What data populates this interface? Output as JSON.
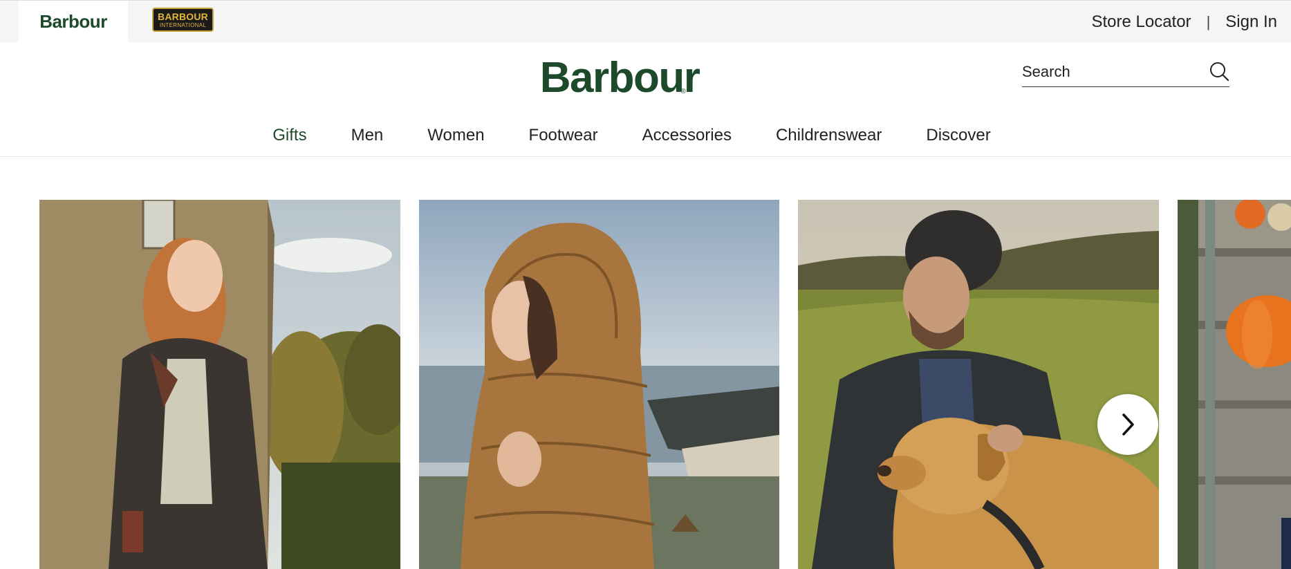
{
  "topbar": {
    "brand_tab": "Barbour",
    "intl_badge_line1": "BARBOUR",
    "intl_badge_line2": "INTERNATIONAL",
    "store_locator": "Store Locator",
    "separator": "|",
    "sign_in": "Sign In"
  },
  "header": {
    "logo": "Barbour",
    "logo_mark": "®",
    "search_placeholder": "Search",
    "search_icon": "search-icon"
  },
  "nav": {
    "items": [
      {
        "label": "Gifts",
        "active": true
      },
      {
        "label": "Men"
      },
      {
        "label": "Women"
      },
      {
        "label": "Footwear"
      },
      {
        "label": "Accessories"
      },
      {
        "label": "Childrenswear"
      },
      {
        "label": "Discover"
      }
    ]
  },
  "carousel": {
    "next_icon": "chevron-right-icon"
  },
  "colors": {
    "brand_green": "#1d4a2a",
    "topbar_bg": "#f5f5f5",
    "intl_gold": "#e4b53a"
  }
}
